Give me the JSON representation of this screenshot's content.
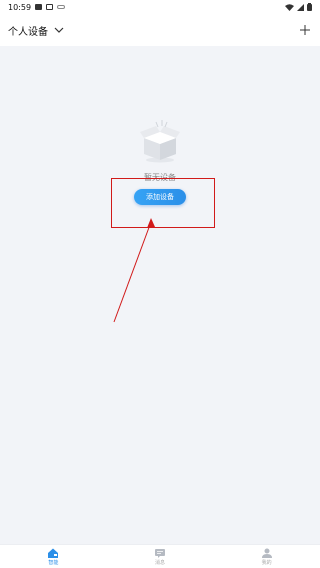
{
  "status_bar": {
    "time": "10:59"
  },
  "header": {
    "title": "个人设备"
  },
  "empty_state": {
    "message": "暂无设备",
    "add_button": "添加设备"
  },
  "bottom_nav": {
    "items": [
      {
        "label": "智能",
        "icon": "home-icon",
        "active": true
      },
      {
        "label": "消息",
        "icon": "message-icon",
        "active": false
      },
      {
        "label": "我的",
        "icon": "person-icon",
        "active": false
      }
    ]
  },
  "colors": {
    "accent": "#2b8fe8",
    "annotation": "#d11a1a",
    "background": "#f2f4f8"
  }
}
